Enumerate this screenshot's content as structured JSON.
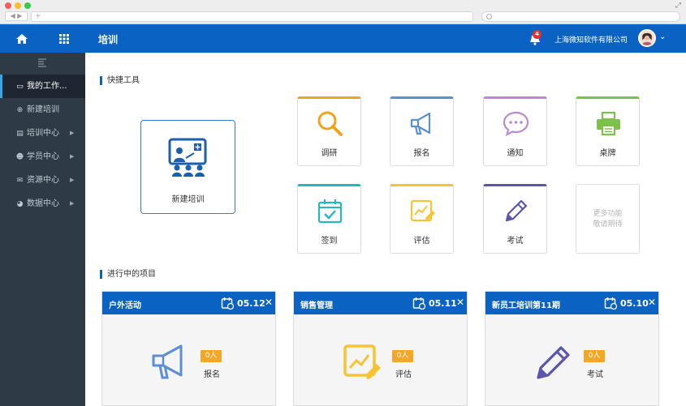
{
  "browser": {
    "url_placeholder": "+",
    "nav_label": "◀ ▶"
  },
  "header": {
    "title": "培训",
    "notifications_count": "4",
    "company": "上海微知软件有限公司",
    "icons": [
      "home-icon",
      "apps-grid-icon",
      "bell-icon",
      "chevron-down-icon"
    ],
    "brand_color": "#0a63c2"
  },
  "sidebar": {
    "items": [
      {
        "label": "我的工作...",
        "icon": "monitor-icon",
        "active": true
      },
      {
        "label": "新建培训",
        "icon": "plus-circle-icon",
        "active": false
      },
      {
        "label": "培训中心",
        "icon": "training-icon",
        "active": false,
        "has_arrow": true
      },
      {
        "label": "学员中心",
        "icon": "users-icon",
        "active": false,
        "has_arrow": true
      },
      {
        "label": "资源中心",
        "icon": "mail-icon",
        "active": false,
        "has_arrow": true
      },
      {
        "label": "数据中心",
        "icon": "pie-chart-icon",
        "active": false,
        "has_arrow": true
      }
    ]
  },
  "quick_tools": {
    "title": "快捷工具",
    "new_training": "新建培训",
    "tools": [
      {
        "label": "调研",
        "icon": "search-icon",
        "color": "#f0a21c"
      },
      {
        "label": "报名",
        "icon": "megaphone-icon",
        "color": "#5a8fd6"
      },
      {
        "label": "通知",
        "icon": "chat-icon",
        "color": "#b98ad2"
      },
      {
        "label": "桌牌",
        "icon": "printer-icon",
        "color": "#7cc24a"
      },
      {
        "label": "签到",
        "icon": "calendar-check-icon",
        "color": "#23b7c7"
      },
      {
        "label": "评估",
        "icon": "chart-edit-icon",
        "color": "#f5c431"
      },
      {
        "label": "考试",
        "icon": "pencil-icon",
        "color": "#5b55b0"
      }
    ],
    "more_line1": "更多功能",
    "more_line2": "敬请期待"
  },
  "projects": {
    "title": "进行中的项目",
    "items": [
      {
        "name": "户外活动",
        "date": "05.12",
        "count": "0人",
        "label": "报名",
        "icon": "megaphone-icon"
      },
      {
        "name": "销售管理",
        "date": "05.11",
        "count": "0人",
        "label": "评估",
        "icon": "chart-edit-icon"
      },
      {
        "name": "新员工培训第11期",
        "date": "05.10",
        "count": "0人",
        "label": "考试",
        "icon": "pencil-icon"
      }
    ],
    "close_label": "✕"
  }
}
